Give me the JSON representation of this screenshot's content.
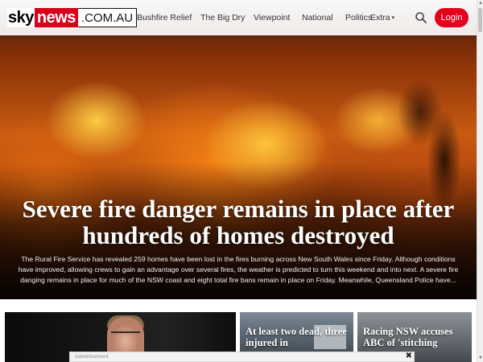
{
  "logo": {
    "part1": "sky",
    "part2": "news",
    "part3": ".COM.AU"
  },
  "nav": {
    "items": [
      {
        "label": "Bushfire Relief"
      },
      {
        "label": "The Big Dry"
      },
      {
        "label": "Viewpoint"
      },
      {
        "label": "National"
      },
      {
        "label": "Politics"
      },
      {
        "label": "Extra",
        "caret": "▾"
      }
    ],
    "search_icon": "search-icon",
    "login_label": "Login"
  },
  "hero": {
    "title": "Severe fire danger remains in place after hundreds of homes destroyed",
    "summary": "The Rural Fire Service has revealed 259 homes have been lost in the fires burning across New South Wales since Friday. Although conditions have improved, allowing crews to gain an advantage over several fires, the weather is predicted to turn this weekend and into next. A severe fire danging remains in place for much of the NSW coast and eight total fire bans remain in place on Friday. Meanwhile, Queensland Police have..."
  },
  "cards": [
    {
      "title": ""
    },
    {
      "title": "At least two dead, three injured in"
    },
    {
      "title": "Racing NSW accuses ABC of 'stitching"
    }
  ],
  "ad": {
    "label": "Advertisement",
    "close": "✖"
  },
  "colors": {
    "brand_red": "#d7001b",
    "login_red": "#e4001b"
  }
}
